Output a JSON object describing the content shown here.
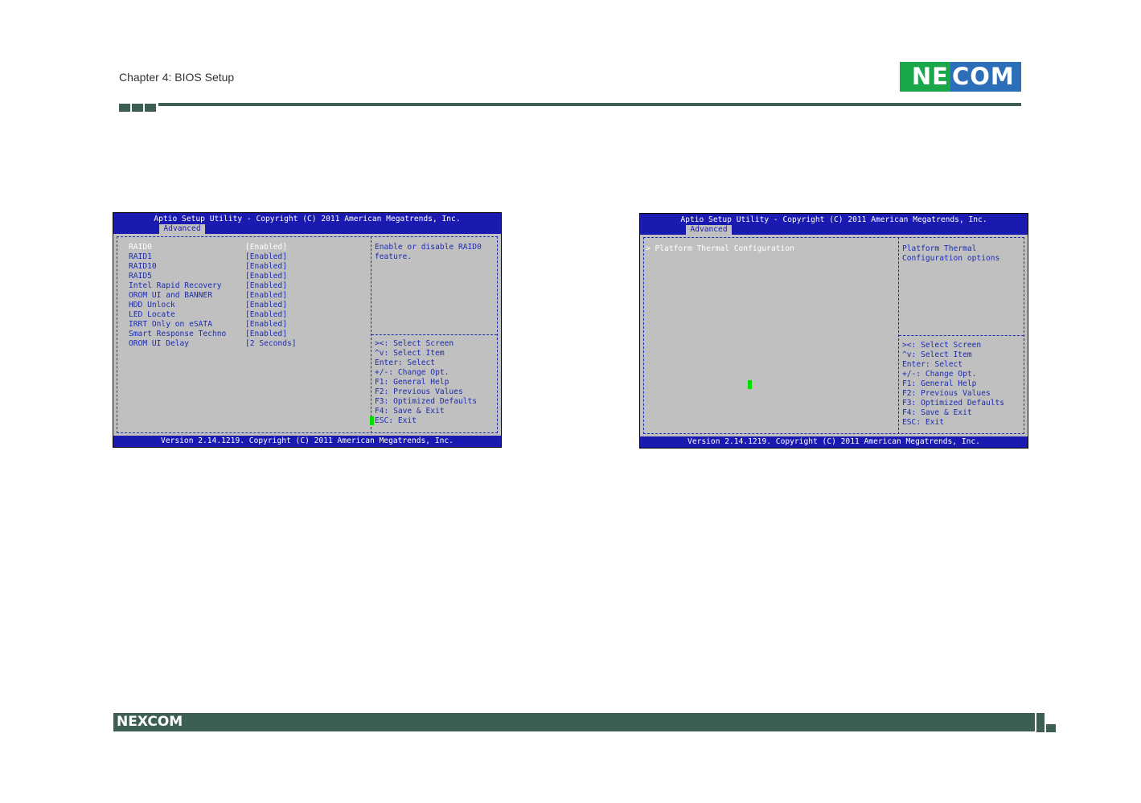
{
  "page": {
    "chapter": "Chapter 4: BIOS Setup",
    "logo_left": "NE",
    "logo_right": "COM",
    "footer_logo": "NEXCOM"
  },
  "screen_left": {
    "title": "Aptio Setup Utility - Copyright (C) 2011 American Megatrends, Inc.",
    "tab": "Advanced",
    "footer": "Version 2.14.1219. Copyright (C) 2011 American Megatrends, Inc.",
    "items": [
      {
        "label": "RAID0",
        "value": "[Enabled]"
      },
      {
        "label": "RAID1",
        "value": "[Enabled]"
      },
      {
        "label": "RAID10",
        "value": "[Enabled]"
      },
      {
        "label": "RAID5",
        "value": "[Enabled]"
      },
      {
        "label": "Intel Rapid Recovery",
        "value": "[Enabled]"
      },
      {
        "label": "OROM UI and BANNER",
        "value": "[Enabled]"
      },
      {
        "label": "HDD Unlock",
        "value": "[Enabled]"
      },
      {
        "label": "LED Locate",
        "value": "[Enabled]"
      },
      {
        "label": "IRRT Only on eSATA",
        "value": "[Enabled]"
      },
      {
        "label": "Smart Response Techno",
        "value": "[Enabled]"
      },
      {
        "label": "OROM UI Delay",
        "value": "[2 Seconds]"
      }
    ],
    "help": [
      "Enable or disable RAID0",
      "feature."
    ],
    "keys": [
      "><: Select Screen",
      "^v: Select Item",
      "Enter: Select",
      "+/-: Change Opt.",
      "F1: General Help",
      "F2: Previous Values",
      "F3: Optimized Defaults",
      "F4: Save & Exit",
      "ESC: Exit"
    ]
  },
  "screen_right": {
    "title": "Aptio Setup Utility - Copyright (C) 2011 American Megatrends, Inc.",
    "tab": "Advanced",
    "footer": "Version 2.14.1219. Copyright (C) 2011 American Megatrends, Inc.",
    "items": [
      {
        "label": "> Platform Thermal Configuration"
      }
    ],
    "help": [
      "Platform Thermal",
      "Configuration options"
    ],
    "keys": [
      "><: Select Screen",
      "^v: Select Item",
      "Enter: Select",
      "+/-: Change Opt.",
      "F1: General Help",
      "F2: Previous Values",
      "F3: Optimized Defaults",
      "F4: Save & Exit",
      "ESC: Exit"
    ]
  }
}
